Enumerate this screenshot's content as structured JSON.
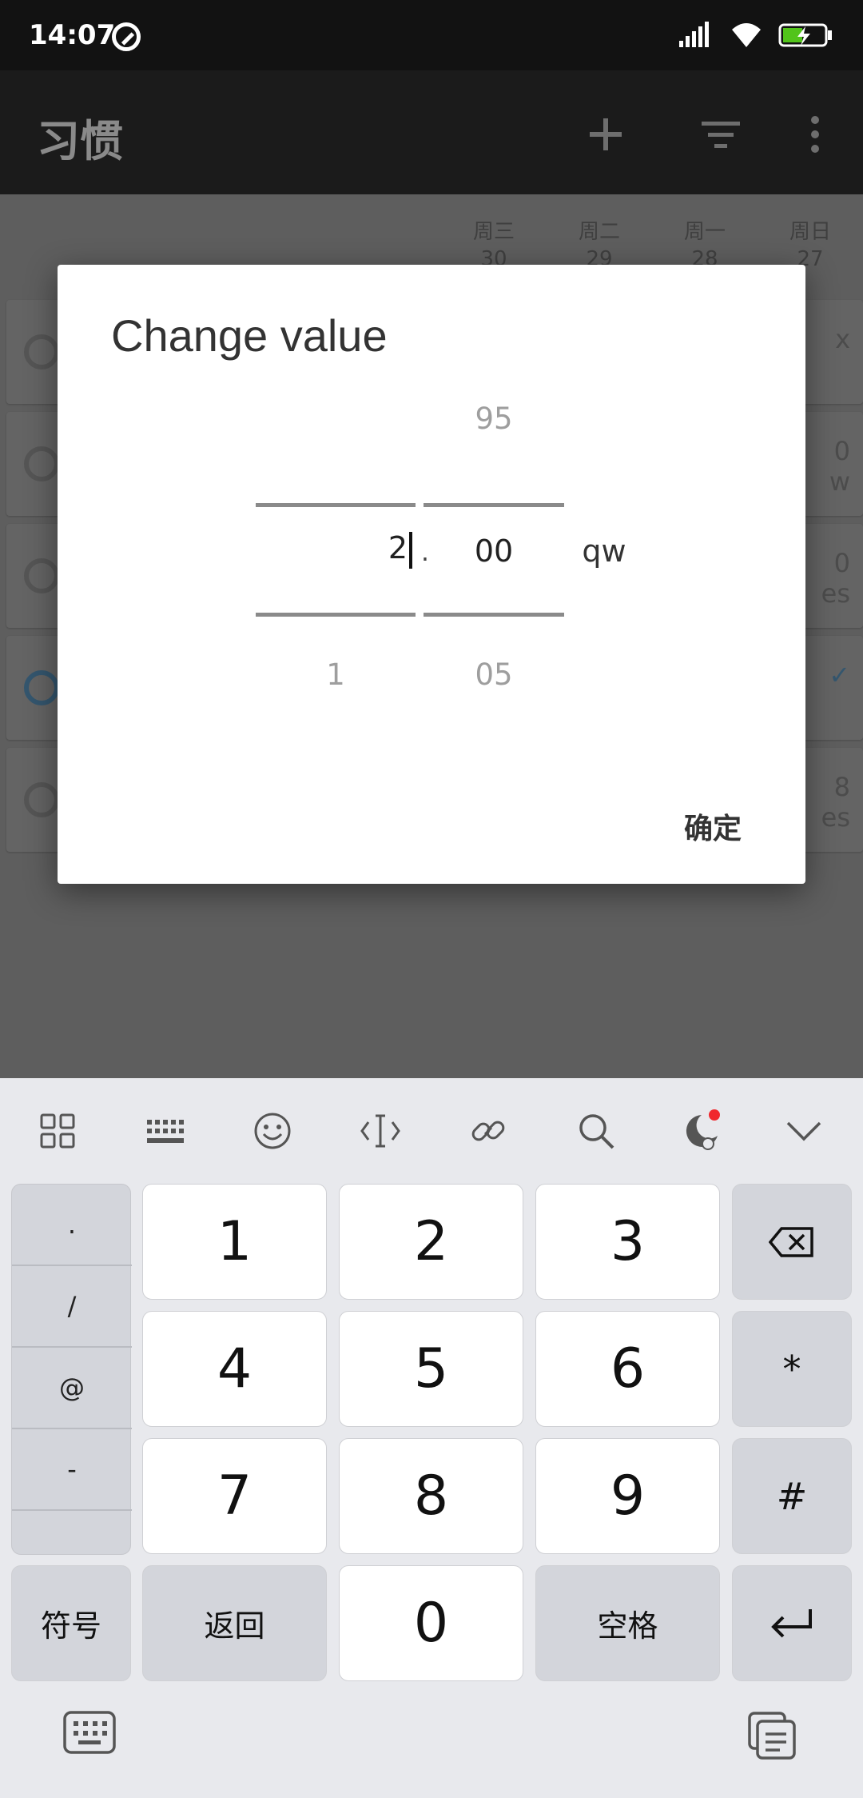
{
  "status_bar": {
    "time": "14:07"
  },
  "app_bar": {
    "title": "习惯"
  },
  "day_headers": [
    {
      "day": "周三",
      "date": "30"
    },
    {
      "day": "周二",
      "date": "29"
    },
    {
      "day": "周一",
      "date": "28"
    },
    {
      "day": "周日",
      "date": "27"
    }
  ],
  "habit_rows": [
    {
      "right_top": "x",
      "right_bottom": ""
    },
    {
      "right_top": "0",
      "right_bottom": "w"
    },
    {
      "right_top": "0",
      "right_bottom": "es"
    },
    {
      "right_top": "✓",
      "right_bottom": ""
    },
    {
      "right_top": "8",
      "right_bottom": "es"
    }
  ],
  "dialog": {
    "title": "Change value",
    "integer_above": "",
    "integer_value": "2",
    "integer_below": "1",
    "separator": ".",
    "decimal_above": "95",
    "decimal_value": "00",
    "decimal_below": "05",
    "unit": "qw",
    "ok_label": "确定"
  },
  "keyboard": {
    "symbols": [
      ".",
      "/",
      "@",
      "-",
      ""
    ],
    "digits": [
      "1",
      "2",
      "3",
      "4",
      "5",
      "6",
      "7",
      "8",
      "9",
      "0"
    ],
    "right_keys": [
      "*",
      "#"
    ],
    "symbol_key": "符号",
    "back_key": "返回",
    "space_key": "空格"
  }
}
